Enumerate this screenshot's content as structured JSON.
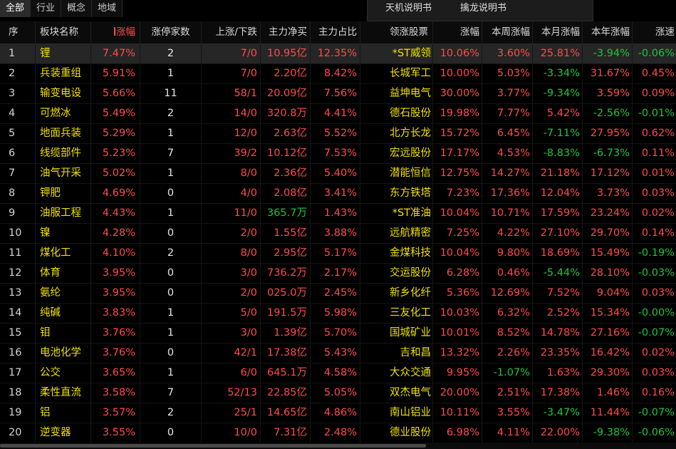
{
  "tabs": [
    "全部",
    "行业",
    "概念",
    "地域"
  ],
  "dropdown": {
    "items": [
      "天机说明书",
      "擒龙说明书"
    ]
  },
  "columns": {
    "idx": "序",
    "name": "板块名称",
    "pct": "涨幅",
    "limit_up": "涨停家数",
    "up_down": "上涨/下跌",
    "net_buy": "主力净买",
    "ratio": "主力占比",
    "lead_stock": "领涨股票",
    "lead_pct": "涨幅",
    "week": "本周涨幅",
    "month": "本月涨幅",
    "year": "本年涨幅",
    "more": "涨速"
  },
  "colors": {
    "up": "#ff4b4b",
    "down": "#1ec63a",
    "name": "#f0e000",
    "selected_row": "#262626"
  },
  "rows": [
    {
      "idx": "1",
      "name": "锂",
      "pct": "7.47%",
      "limit_up": "2",
      "up_down": "7/0",
      "net_buy": "10.95亿",
      "ratio": "12.35%",
      "lead_stock": "*ST威领",
      "lead_pct": "10.06%",
      "week": "3.60%",
      "month": "25.81%",
      "year": "-3.94%",
      "more": "-0.06%"
    },
    {
      "idx": "2",
      "name": "兵装重组",
      "pct": "5.91%",
      "limit_up": "1",
      "up_down": "7/0",
      "net_buy": "2.20亿",
      "ratio": "8.42%",
      "lead_stock": "长城军工",
      "lead_pct": "10.00%",
      "week": "5.03%",
      "month": "-3.34%",
      "year": "31.67%",
      "more": "0.45%"
    },
    {
      "idx": "3",
      "name": "输变电设",
      "pct": "5.66%",
      "limit_up": "11",
      "up_down": "58/1",
      "net_buy": "20.09亿",
      "ratio": "7.56%",
      "lead_stock": "益坤电气",
      "lead_pct": "30.00%",
      "week": "3.77%",
      "month": "-9.34%",
      "year": "3.59%",
      "more": "0.09%"
    },
    {
      "idx": "4",
      "name": "可燃冰",
      "pct": "5.49%",
      "limit_up": "2",
      "up_down": "14/0",
      "net_buy": "320.8万",
      "ratio": "4.41%",
      "lead_stock": "德石股份",
      "lead_pct": "19.98%",
      "week": "7.77%",
      "month": "5.42%",
      "year": "-2.56%",
      "more": "-0.01%"
    },
    {
      "idx": "5",
      "name": "地面兵装",
      "pct": "5.29%",
      "limit_up": "1",
      "up_down": "12/0",
      "net_buy": "2.63亿",
      "ratio": "5.52%",
      "lead_stock": "北方长龙",
      "lead_pct": "15.72%",
      "week": "6.45%",
      "month": "-7.11%",
      "year": "27.95%",
      "more": "0.62%"
    },
    {
      "idx": "6",
      "name": "线缆部件",
      "pct": "5.23%",
      "limit_up": "7",
      "up_down": "39/2",
      "net_buy": "10.12亿",
      "ratio": "7.53%",
      "lead_stock": "宏远股份",
      "lead_pct": "17.17%",
      "week": "4.53%",
      "month": "-8.83%",
      "year": "-6.73%",
      "more": "0.11%"
    },
    {
      "idx": "7",
      "name": "油气开采",
      "pct": "5.02%",
      "limit_up": "1",
      "up_down": "8/0",
      "net_buy": "2.36亿",
      "ratio": "5.40%",
      "lead_stock": "潜能恒信",
      "lead_pct": "12.75%",
      "week": "14.27%",
      "month": "21.18%",
      "year": "17.12%",
      "more": "0.01%"
    },
    {
      "idx": "8",
      "name": "钾肥",
      "pct": "4.69%",
      "limit_up": "0",
      "up_down": "4/0",
      "net_buy": "2.08亿",
      "ratio": "3.41%",
      "lead_stock": "东方铁塔",
      "lead_pct": "7.23%",
      "week": "17.36%",
      "month": "12.04%",
      "year": "3.73%",
      "more": "0.03%"
    },
    {
      "idx": "9",
      "name": "油服工程",
      "pct": "4.43%",
      "limit_up": "1",
      "up_down": "11/0",
      "net_buy": "365.7万",
      "ratio": "1.43%",
      "lead_stock": "*ST准油",
      "lead_pct": "10.04%",
      "week": "10.71%",
      "month": "17.59%",
      "year": "23.24%",
      "more": "0.02%"
    },
    {
      "idx": "10",
      "name": "镍",
      "pct": "4.28%",
      "limit_up": "0",
      "up_down": "2/0",
      "net_buy": "1.55亿",
      "ratio": "3.88%",
      "lead_stock": "远航精密",
      "lead_pct": "7.25%",
      "week": "4.22%",
      "month": "27.10%",
      "year": "29.70%",
      "more": "0.14%"
    },
    {
      "idx": "11",
      "name": "煤化工",
      "pct": "4.10%",
      "limit_up": "2",
      "up_down": "8/0",
      "net_buy": "2.95亿",
      "ratio": "5.17%",
      "lead_stock": "金煤科技",
      "lead_pct": "10.04%",
      "week": "9.80%",
      "month": "18.69%",
      "year": "15.49%",
      "more": "-0.19%"
    },
    {
      "idx": "12",
      "name": "体育",
      "pct": "3.95%",
      "limit_up": "0",
      "up_down": "3/0",
      "net_buy": "736.2万",
      "ratio": "2.17%",
      "lead_stock": "交运股份",
      "lead_pct": "6.28%",
      "week": "0.46%",
      "month": "-5.44%",
      "year": "28.10%",
      "more": "-0.03%"
    },
    {
      "idx": "13",
      "name": "氨纶",
      "pct": "3.95%",
      "limit_up": "0",
      "up_down": "2/0",
      "net_buy": "025.0万",
      "ratio": "2.45%",
      "lead_stock": "新乡化纤",
      "lead_pct": "5.36%",
      "week": "12.69%",
      "month": "7.52%",
      "year": "9.04%",
      "more": "0.03%"
    },
    {
      "idx": "14",
      "name": "纯碱",
      "pct": "3.83%",
      "limit_up": "1",
      "up_down": "5/0",
      "net_buy": "191.5万",
      "ratio": "5.98%",
      "lead_stock": "三友化工",
      "lead_pct": "10.03%",
      "week": "6.32%",
      "month": "2.52%",
      "year": "15.34%",
      "more": "-0.00%"
    },
    {
      "idx": "15",
      "name": "钼",
      "pct": "3.76%",
      "limit_up": "1",
      "up_down": "3/0",
      "net_buy": "1.39亿",
      "ratio": "5.70%",
      "lead_stock": "国城矿业",
      "lead_pct": "10.01%",
      "week": "8.52%",
      "month": "14.78%",
      "year": "27.16%",
      "more": "-0.07%"
    },
    {
      "idx": "16",
      "name": "电池化学",
      "pct": "3.76%",
      "limit_up": "0",
      "up_down": "42/1",
      "net_buy": "17.38亿",
      "ratio": "5.43%",
      "lead_stock": "吉和昌",
      "lead_pct": "13.32%",
      "week": "2.26%",
      "month": "23.35%",
      "year": "16.42%",
      "more": "0.02%"
    },
    {
      "idx": "17",
      "name": "公交",
      "pct": "3.65%",
      "limit_up": "1",
      "up_down": "6/0",
      "net_buy": "645.1万",
      "ratio": "4.58%",
      "lead_stock": "大众交通",
      "lead_pct": "9.95%",
      "week": "-1.07%",
      "month": "1.63%",
      "year": "29.30%",
      "more": "0.03%"
    },
    {
      "idx": "18",
      "name": "柔性直流",
      "pct": "3.58%",
      "limit_up": "7",
      "up_down": "52/13",
      "net_buy": "22.85亿",
      "ratio": "5.05%",
      "lead_stock": "双杰电气",
      "lead_pct": "20.00%",
      "week": "2.51%",
      "month": "17.38%",
      "year": "1.46%",
      "more": "0.16%"
    },
    {
      "idx": "19",
      "name": "铝",
      "pct": "3.57%",
      "limit_up": "2",
      "up_down": "25/1",
      "net_buy": "14.65亿",
      "ratio": "4.86%",
      "lead_stock": "南山铝业",
      "lead_pct": "10.11%",
      "week": "3.55%",
      "month": "-3.47%",
      "year": "11.44%",
      "more": "-0.07%"
    },
    {
      "idx": "20",
      "name": "逆变器",
      "pct": "3.55%",
      "limit_up": "0",
      "up_down": "10/0",
      "net_buy": "7.31亿",
      "ratio": "2.48%",
      "lead_stock": "德业股份",
      "lead_pct": "6.98%",
      "week": "4.11%",
      "month": "22.00%",
      "year": "-9.38%",
      "more": "-0.06%"
    }
  ]
}
